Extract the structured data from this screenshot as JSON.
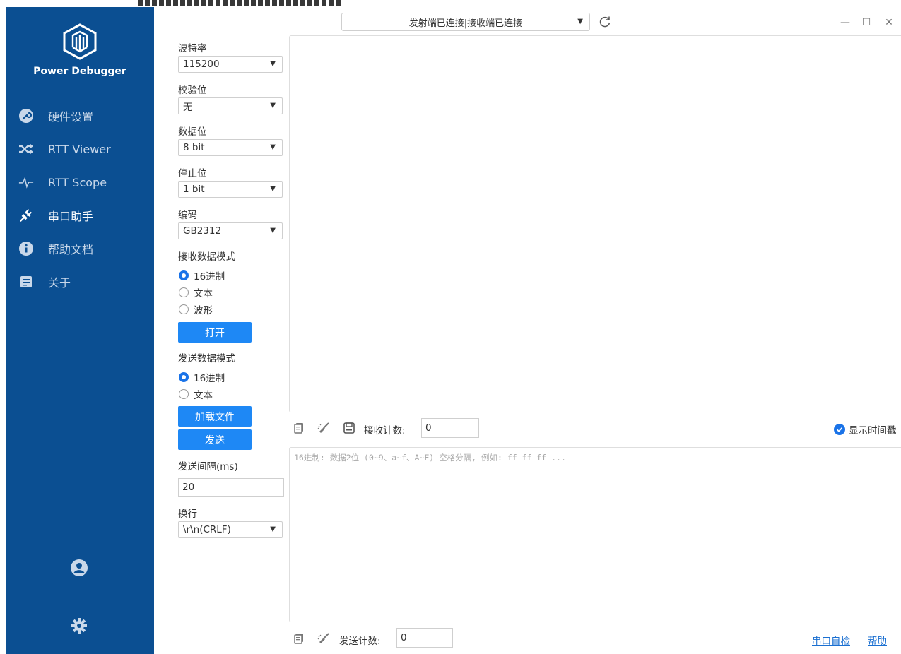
{
  "sidebar": {
    "brand": "Power Debugger",
    "items": [
      {
        "label": "硬件设置",
        "icon": "wrench-icon"
      },
      {
        "label": "RTT Viewer",
        "icon": "shuffle-icon"
      },
      {
        "label": "RTT Scope",
        "icon": "pulse-icon"
      },
      {
        "label": "串口助手",
        "icon": "plug-icon"
      },
      {
        "label": "帮助文档",
        "icon": "info-icon"
      },
      {
        "label": "关于",
        "icon": "document-icon"
      }
    ],
    "active_index": 3,
    "bottom": [
      "user-icon",
      "gear-icon"
    ]
  },
  "settings": {
    "baud_label": "波特率",
    "baud_value": "115200",
    "parity_label": "校验位",
    "parity_value": "无",
    "databits_label": "数据位",
    "databits_value": "8 bit",
    "stopbits_label": "停止位",
    "stopbits_value": "1 bit",
    "encoding_label": "编码",
    "encoding_value": "GB2312",
    "recv_mode_label": "接收数据模式",
    "recv_modes": [
      "16进制",
      "文本",
      "波形"
    ],
    "recv_mode_selected": 0,
    "open_button": "打开",
    "send_mode_label": "发送数据模式",
    "send_modes": [
      "16进制",
      "文本"
    ],
    "send_mode_selected": 0,
    "load_file_button": "加载文件",
    "send_button": "发送",
    "interval_label": "发送间隔(ms)",
    "interval_value": "20",
    "newline_label": "换行",
    "newline_value": "\\r\\n(CRLF)"
  },
  "header": {
    "port_status": "发射端已连接|接收端已连接"
  },
  "receive": {
    "count_label": "接收计数:",
    "count_value": "0",
    "show_timestamp_label": "显示时间戳"
  },
  "send": {
    "placeholder": "16进制: 数据2位 (0~9、a~f、A~F) 空格分隔, 例如: ff ff ff ...",
    "count_label": "发送计数:",
    "count_value": "0",
    "self_test_link": "串口自检",
    "help_link": "帮助"
  },
  "colors": {
    "sidebar_bg": "#0b4f92",
    "accent": "#1e88f5"
  }
}
